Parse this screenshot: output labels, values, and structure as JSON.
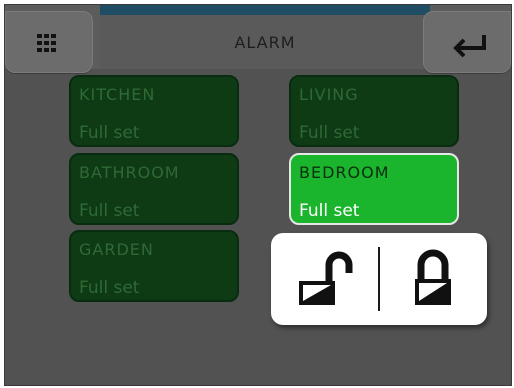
{
  "header": {
    "title": "ALARM",
    "menu_icon": "grid-icon",
    "back_icon": "return-arrow-icon"
  },
  "zones": [
    {
      "name": "KITCHEN",
      "state": "Full set",
      "selected": false
    },
    {
      "name": "LIVING",
      "state": "Full set",
      "selected": false
    },
    {
      "name": "BATHROOM",
      "state": "Full set",
      "selected": false
    },
    {
      "name": "BEDROOM",
      "state": "Full set",
      "selected": true
    },
    {
      "name": "GARDEN",
      "state": "Full set",
      "selected": false
    }
  ],
  "popup": {
    "unlock_icon": "unlock-icon",
    "lock_icon": "lock-icon"
  },
  "colors": {
    "zone_inactive": "#0e3a14",
    "zone_active": "#1bb52d",
    "accent": "#1f4d63"
  }
}
